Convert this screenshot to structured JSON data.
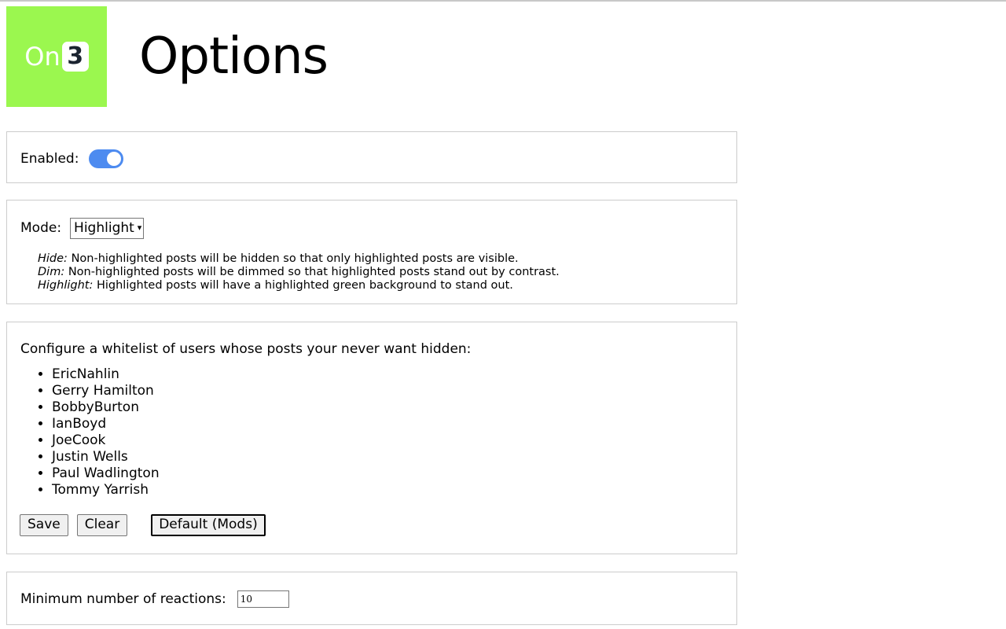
{
  "page": {
    "title": "Options",
    "logo": {
      "text_on": "On",
      "text_three": "3",
      "background_color": "#9BF74F",
      "three_color": "#1b2430"
    }
  },
  "enabled_section": {
    "label": "Enabled:",
    "toggle_state": "on",
    "toggle_color": "#4d8bf0"
  },
  "mode_section": {
    "label": "Mode:",
    "selected": "Highlight",
    "options": [
      "Hide",
      "Dim",
      "Highlight"
    ],
    "descriptions": [
      {
        "term": "Hide:",
        "text": "Non-highlighted posts will be hidden so that only highlighted posts are visible."
      },
      {
        "term": "Dim:",
        "text": "Non-highlighted posts will be dimmed so that highlighted posts stand out by contrast."
      },
      {
        "term": "Highlight:",
        "text": "Highlighted posts will have a highlighted green background to stand out."
      }
    ]
  },
  "whitelist_section": {
    "heading": "Configure a whitelist of users whose posts your never want hidden:",
    "users": [
      "EricNahlin",
      "Gerry Hamilton",
      "BobbyBurton",
      "IanBoyd",
      "JoeCook",
      "Justin Wells",
      "Paul Wadlington",
      "Tommy Yarrish"
    ],
    "buttons": {
      "save": "Save",
      "clear": "Clear",
      "default": "Default (Mods)"
    }
  },
  "reactions_section": {
    "label": "Minimum number of reactions:",
    "value": "10"
  }
}
